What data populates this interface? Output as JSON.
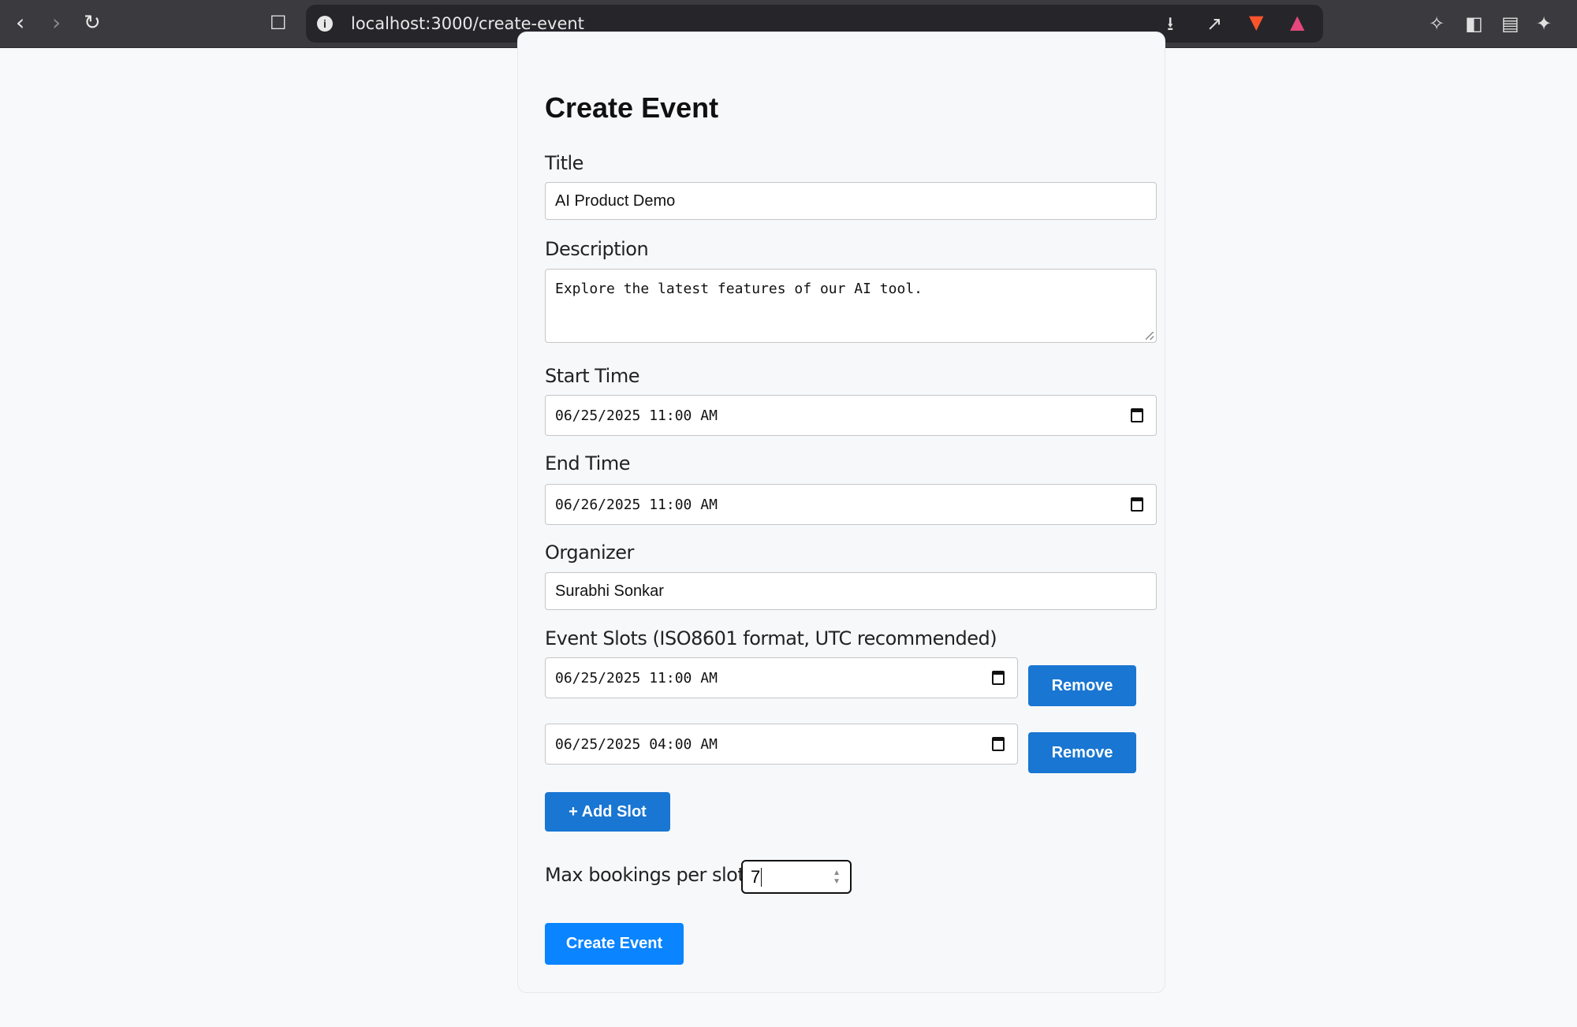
{
  "browser": {
    "url_host": "localhost",
    "url_path": ":3000/create-event"
  },
  "page": {
    "title": "Create Event"
  },
  "form": {
    "title_label": "Title",
    "title_value": "AI Product Demo",
    "description_label": "Description",
    "description_value": "Explore the latest features of our AI tool.",
    "start_label": "Start Time",
    "start_value": "06/25/2025 11:00 AM",
    "end_label": "End Time",
    "end_value": "06/26/2025 11:00 AM",
    "organizer_label": "Organizer",
    "organizer_value": "Surabhi Sonkar",
    "slots_label": "Event Slots (ISO8601 format, UTC recommended)",
    "slots": [
      {
        "value": "06/25/2025 11:00 AM",
        "remove_label": "Remove"
      },
      {
        "value": "06/25/2025 04:00 AM",
        "remove_label": "Remove"
      }
    ],
    "add_slot_label": "+ Add Slot",
    "max_label": "Max bookings per slot",
    "max_value": "7",
    "submit_label": "Create Event"
  },
  "colors": {
    "remove": "#1976d2",
    "submit": "#0a84ff"
  }
}
